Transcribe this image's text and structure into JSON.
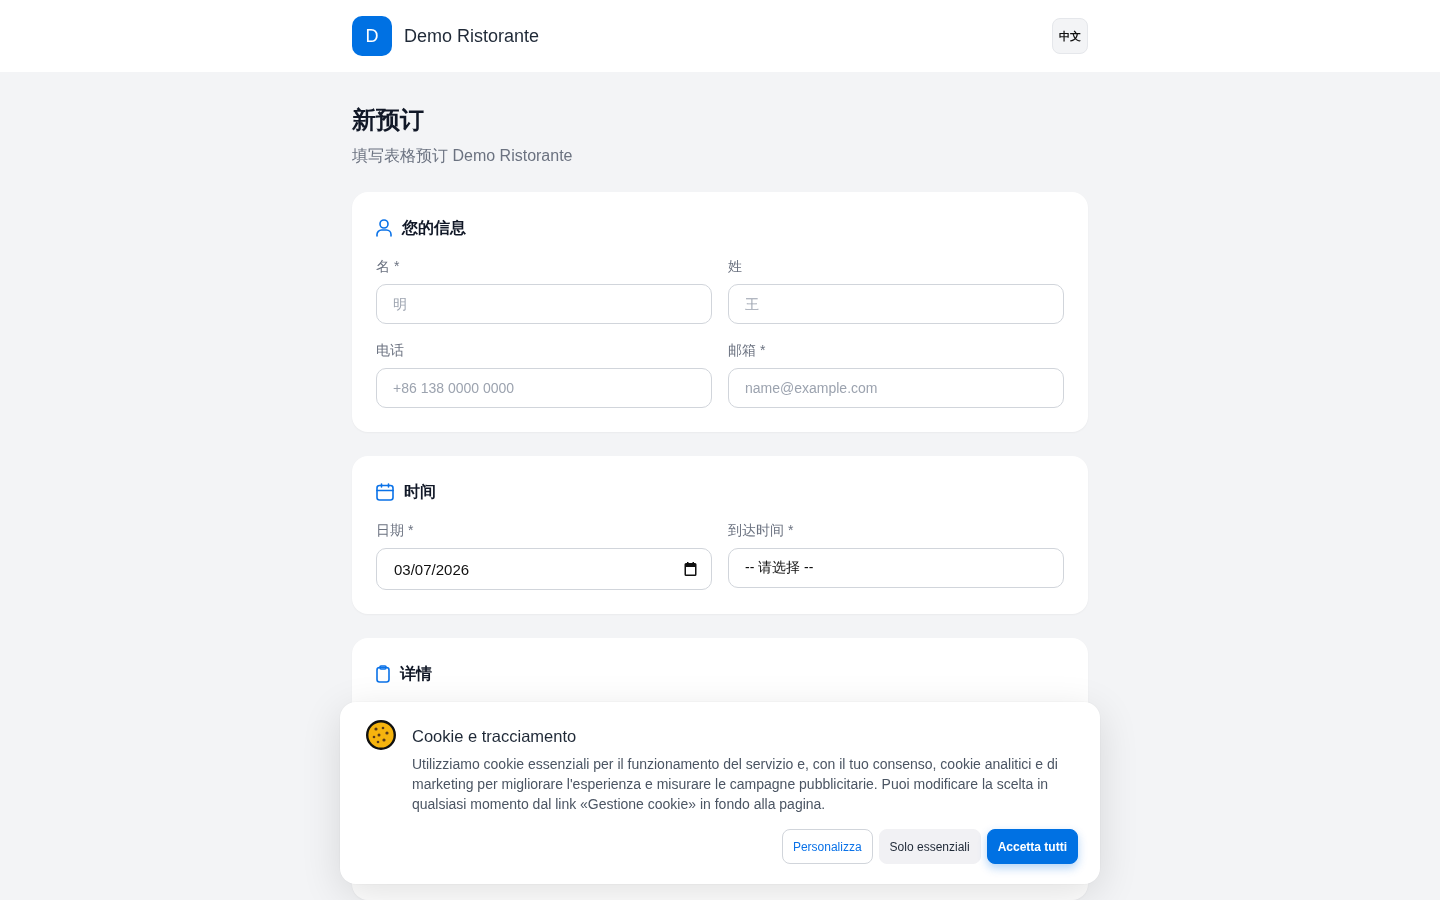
{
  "header": {
    "logo_letter": "D",
    "title": "Demo Ristorante",
    "language_button": "中文"
  },
  "page": {
    "title": "新预订",
    "subtitle": "填写表格预订 Demo Ristorante"
  },
  "sections": [
    {
      "title": "您的信息",
      "fields": [
        {
          "kind": "text",
          "label": "名 *",
          "placeholder": "明"
        },
        {
          "kind": "text",
          "label": "姓",
          "placeholder": "王"
        },
        {
          "kind": "text",
          "label": "电话",
          "placeholder": "+86 138 0000 0000"
        },
        {
          "kind": "text",
          "label": "邮箱 *",
          "placeholder": "name@example.com"
        }
      ]
    },
    {
      "title": "时间",
      "fields": [
        {
          "kind": "date",
          "label": "日期 *",
          "value": "03/07/2026"
        },
        {
          "kind": "select",
          "label": "到达时间 *",
          "value": "-- 请选择 --"
        }
      ]
    },
    {
      "title": "详情"
    }
  ],
  "cookie_banner": {
    "title": "Cookie e tracciamento",
    "text": "Utilizziamo cookie essenziali per il funzionamento del servizio e, con il tuo consenso, cookie analitici e di marketing per migliorare l'esperienza e misurare le campagne pubblicitarie. Puoi modificare la scelta in qualsiasi momento dal link «Gestione cookie» in fondo alla pagina.",
    "buttons": [
      {
        "kind": "outline",
        "label": "Personalizza"
      },
      {
        "kind": "secondary",
        "label": "Solo essenziali"
      },
      {
        "kind": "primary",
        "label": "Accetta tutti"
      }
    ]
  }
}
